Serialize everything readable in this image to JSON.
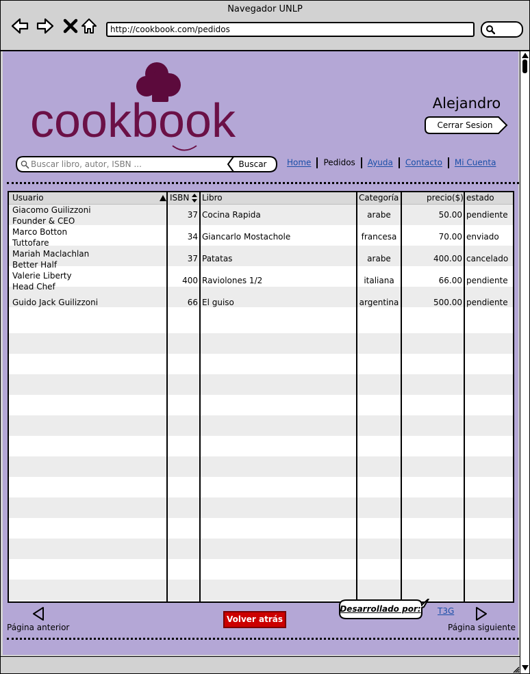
{
  "browser": {
    "title": "Navegador UNLP",
    "url": "http://cookbook.com/pedidos",
    "icons": [
      "back-arrow-icon",
      "forward-arrow-icon",
      "stop-icon",
      "home-icon",
      "search-icon"
    ]
  },
  "header": {
    "logo_text": "cookbook",
    "username": "Alejandro",
    "logout_label": "Cerrar Sesion"
  },
  "search": {
    "placeholder": "Buscar libro, autor, ISBN ...",
    "button_label": "Buscar"
  },
  "nav": {
    "home": "Home",
    "pedidos": "Pedidos",
    "ayuda": "Ayuda",
    "contacto": "Contacto",
    "mi_cuenta": "Mi Cuenta"
  },
  "table": {
    "columns": {
      "usuario": "Usuario",
      "isbn": "ISBN",
      "libro": "Libro",
      "categoria": "Categoría",
      "precio": "precio($)",
      "estado": "estado"
    },
    "rows": [
      {
        "user1": "Giacomo Guilizzoni",
        "user2": "Founder & CEO",
        "isbn": "37",
        "libro": "Cocina Rapida",
        "categoria": "arabe",
        "precio": "50.00",
        "estado": "pendiente"
      },
      {
        "user1": "Marco Botton",
        "user2": "Tuttofare",
        "isbn": "34",
        "libro": "Giancarlo Mostachole",
        "categoria": "francesa",
        "precio": "70.00",
        "estado": "enviado"
      },
      {
        "user1": "Mariah Maclachlan",
        "user2": "Better Half",
        "isbn": "37",
        "libro": "Patatas",
        "categoria": "arabe",
        "precio": "400.00",
        "estado": "cancelado"
      },
      {
        "user1": "Valerie Liberty",
        "user2": "Head Chef",
        "isbn": "400",
        "libro": "Raviolones 1/2",
        "categoria": "italiana",
        "precio": "66.00",
        "estado": "pendiente"
      },
      {
        "user1": "Guido Jack Guilizzoni",
        "user2": "",
        "isbn": "66",
        "libro": "El guiso",
        "categoria": "argentina",
        "precio": "500.00",
        "estado": "pendiente"
      }
    ]
  },
  "pagination": {
    "prev_label": "Página anterior",
    "next_label": "Página siguiente",
    "back_label": "Volver atrás"
  },
  "footer": {
    "credits_label": "Desarrollado por:",
    "credits_link": "T3G"
  },
  "colors": {
    "page_background": "#b4a7d6",
    "logo_purple": "#5c0a3c",
    "back_button": "#cc0000",
    "link": "#1a4ea8"
  }
}
